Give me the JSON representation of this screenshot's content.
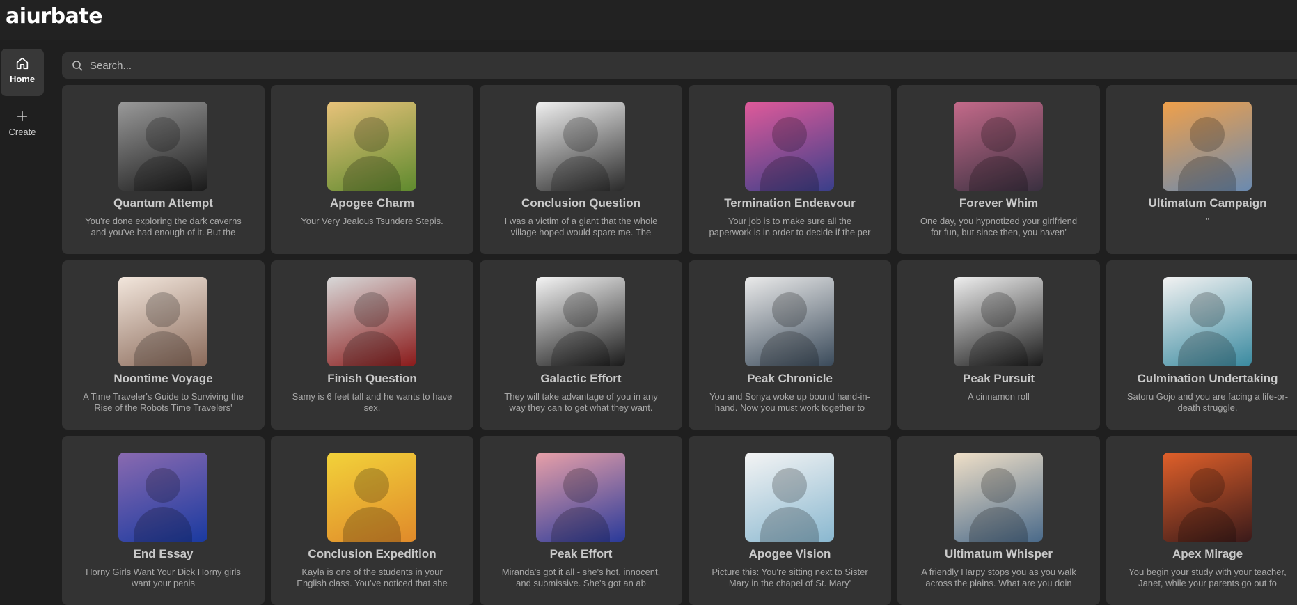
{
  "app": {
    "logo": "aiurbate"
  },
  "sidebar": {
    "items": [
      {
        "label": "Home",
        "icon": "home-icon",
        "active": true
      },
      {
        "label": "Create",
        "icon": "plus-icon",
        "active": false
      }
    ]
  },
  "search": {
    "placeholder": "Search..."
  },
  "cards": [
    {
      "title": "Quantum Attempt",
      "desc": "You're done exploring the dark caverns and you've had enough of it. But the",
      "colors": [
        "#9a9a9a",
        "#1a1a1a"
      ]
    },
    {
      "title": "Apogee Charm",
      "desc": "Your Very Jealous Tsundere Stepis.",
      "colors": [
        "#e8c27a",
        "#5f8a2e"
      ]
    },
    {
      "title": "Conclusion Question",
      "desc": "I was a victim of a giant that the whole village hoped would spare me. The",
      "colors": [
        "#f0f0f0",
        "#2a2a2a"
      ]
    },
    {
      "title": "Termination Endeavour",
      "desc": "Your job is to make sure all the paperwork is in order to decide if the per",
      "colors": [
        "#e05a9a",
        "#3a3f8a"
      ]
    },
    {
      "title": "Forever Whim",
      "desc": "One day, you hypnotized your girlfriend for fun, but since then, you haven'",
      "colors": [
        "#c46a8a",
        "#3a3040"
      ]
    },
    {
      "title": "Ultimatum Campaign",
      "desc": "\"",
      "colors": [
        "#f0a04a",
        "#6a8ab0"
      ]
    },
    {
      "title": "Noontime Voyage",
      "desc": "A Time Traveler's Guide to Surviving the Rise of the Robots Time Travelers'",
      "colors": [
        "#f2e6dc",
        "#8a6a5a"
      ]
    },
    {
      "title": "Finish Question",
      "desc": "Samy is 6 feet tall and he wants to have sex.",
      "colors": [
        "#d8d8d8",
        "#8a1a1a"
      ]
    },
    {
      "title": "Galactic Effort",
      "desc": "They will take advantage of you in any way they can to get what they want.",
      "colors": [
        "#f4f4f4",
        "#1a1a1a"
      ]
    },
    {
      "title": "Peak Chronicle",
      "desc": "You and Sonya woke up bound hand-in-hand. Now you must work together to get",
      "colors": [
        "#eaeaea",
        "#3a4a5a"
      ]
    },
    {
      "title": "Peak Pursuit",
      "desc": "A cinnamon roll",
      "colors": [
        "#eeeeee",
        "#1a1a1a"
      ]
    },
    {
      "title": "Culmination Undertaking",
      "desc": "Satoru Gojo and you are facing a life-or-death struggle.",
      "colors": [
        "#f2f2f2",
        "#3a8aa0"
      ]
    },
    {
      "title": "End Essay",
      "desc": "Horny Girls Want Your Dick Horny girls want your penis",
      "colors": [
        "#8a6ab0",
        "#1a3aa0"
      ]
    },
    {
      "title": "Conclusion Expedition",
      "desc": "Kayla is one of the students in your English class. You've noticed that she",
      "colors": [
        "#f2d23a",
        "#e08a2a"
      ]
    },
    {
      "title": "Peak Effort",
      "desc": "Miranda's got it all - she's hot, innocent, and submissive. She's got an ab",
      "colors": [
        "#e8a0a8",
        "#2a3a9a"
      ]
    },
    {
      "title": "Apogee Vision",
      "desc": "Picture this: You're sitting next to Sister Mary in the chapel of St. Mary'",
      "colors": [
        "#f4f4f4",
        "#8ab8d0"
      ]
    },
    {
      "title": "Ultimatum Whisper",
      "desc": "A friendly Harpy stops you as you walk across the plains. What are you doin",
      "colors": [
        "#f0e0c8",
        "#4a6a8a"
      ]
    },
    {
      "title": "Apex Mirage",
      "desc": "You begin your study with your teacher, Janet, while your parents go out fo",
      "colors": [
        "#e0602a",
        "#3a1a1a"
      ]
    }
  ]
}
